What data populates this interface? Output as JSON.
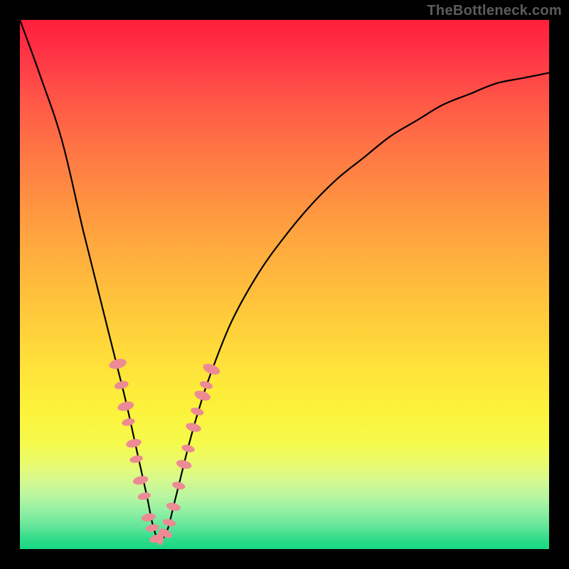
{
  "watermark": {
    "text": "TheBottleneck.com"
  },
  "colors": {
    "frame_bg": "#000000",
    "curve": "#000000",
    "marker": "#ec8b94",
    "gradient_top": "#ff1f3a",
    "gradient_bottom": "#17d883"
  },
  "chart_data": {
    "type": "line",
    "title": "",
    "xlabel": "",
    "ylabel": "",
    "xlim": [
      0,
      100
    ],
    "ylim": [
      0,
      100
    ],
    "grid": false,
    "legend": false,
    "note": "Bottleneck-style V curve. y=0 is green (no bottleneck), y=100 is red (severe). Minimum around x≈26.",
    "series": [
      {
        "name": "bottleneck-curve",
        "x": [
          0,
          4,
          8,
          12,
          16,
          18,
          20,
          22,
          24,
          25,
          26,
          27,
          28,
          29,
          30,
          32,
          34,
          36,
          40,
          45,
          50,
          55,
          60,
          65,
          70,
          75,
          80,
          85,
          90,
          95,
          100
        ],
        "y": [
          100,
          89,
          77,
          60,
          44,
          36,
          28,
          19,
          10,
          5,
          2,
          2,
          4,
          8,
          12,
          20,
          27,
          33,
          43,
          52,
          59,
          65,
          70,
          74,
          78,
          81,
          84,
          86,
          88,
          89,
          90
        ]
      }
    ],
    "markers": {
      "name": "highlighted-points",
      "points": [
        {
          "x": 18.5,
          "y": 35,
          "r": 1.6
        },
        {
          "x": 19.2,
          "y": 31,
          "r": 1.3
        },
        {
          "x": 20.0,
          "y": 27,
          "r": 1.5
        },
        {
          "x": 20.5,
          "y": 24,
          "r": 1.2
        },
        {
          "x": 21.5,
          "y": 20,
          "r": 1.4
        },
        {
          "x": 22.0,
          "y": 17,
          "r": 1.2
        },
        {
          "x": 22.8,
          "y": 13,
          "r": 1.4
        },
        {
          "x": 23.5,
          "y": 10,
          "r": 1.2
        },
        {
          "x": 24.3,
          "y": 6,
          "r": 1.3
        },
        {
          "x": 25.0,
          "y": 4,
          "r": 1.2
        },
        {
          "x": 25.8,
          "y": 2,
          "r": 1.3
        },
        {
          "x": 26.5,
          "y": 2,
          "r": 1.2
        },
        {
          "x": 27.5,
          "y": 3,
          "r": 1.3
        },
        {
          "x": 28.2,
          "y": 5,
          "r": 1.2
        },
        {
          "x": 29.0,
          "y": 8,
          "r": 1.3
        },
        {
          "x": 30.0,
          "y": 12,
          "r": 1.2
        },
        {
          "x": 31.0,
          "y": 16,
          "r": 1.4
        },
        {
          "x": 31.8,
          "y": 19,
          "r": 1.2
        },
        {
          "x": 32.8,
          "y": 23,
          "r": 1.4
        },
        {
          "x": 33.5,
          "y": 26,
          "r": 1.2
        },
        {
          "x": 34.5,
          "y": 29,
          "r": 1.5
        },
        {
          "x": 35.2,
          "y": 31,
          "r": 1.2
        },
        {
          "x": 36.2,
          "y": 34,
          "r": 1.6
        }
      ]
    }
  }
}
